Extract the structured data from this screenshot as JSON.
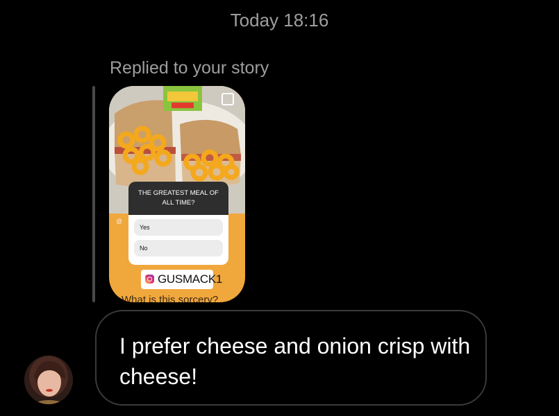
{
  "thread": {
    "timestamp": "Today 18:16",
    "replied_label": "Replied to your story"
  },
  "story": {
    "at_prefix": "@",
    "poll": {
      "question": "THE GREATEST MEAL OF ALL TIME?",
      "options": [
        "Yes",
        "No"
      ]
    },
    "mention_tag": "GUSMACK1",
    "partial_caption": "What is this sorcery?"
  },
  "message": {
    "text": "I prefer cheese and onion crisp with cheese!"
  },
  "colors": {
    "background": "#000000",
    "muted_text": "#9e9e9e",
    "bubble_border": "#3a3a3a",
    "story_bg": "#f0a73c"
  }
}
